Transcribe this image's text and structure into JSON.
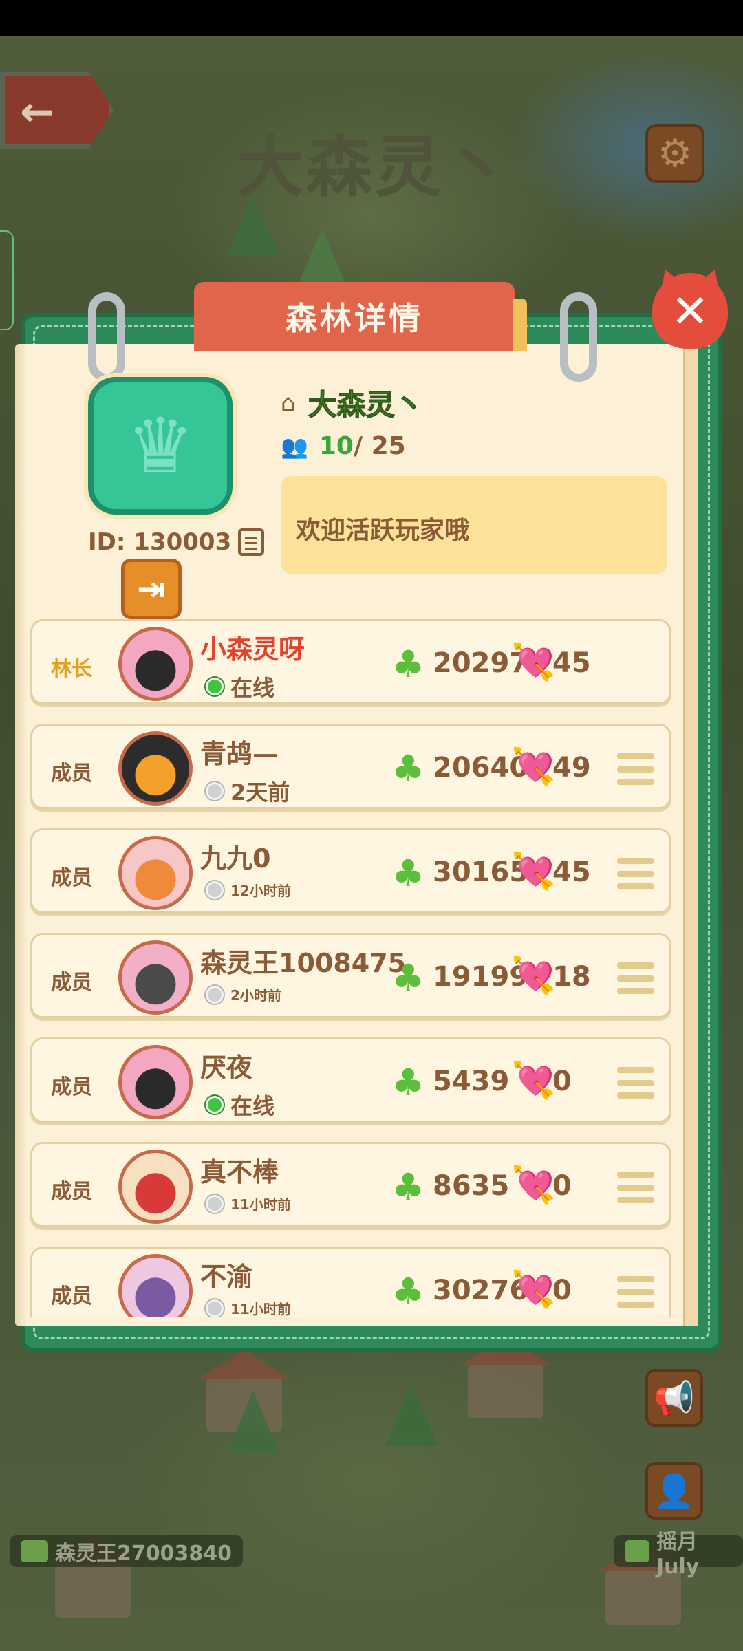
{
  "background": {
    "title": "大森灵丶",
    "bottom_names": [
      "森灵王27003840",
      "摇月July"
    ]
  },
  "panel": {
    "title": "森林详情",
    "forest": {
      "name": "大森灵丶",
      "member_count": "10",
      "member_max": "/ 25",
      "id_label": "ID: 130003",
      "notice": "欢迎活跃玩家哦"
    }
  },
  "members": [
    {
      "role": "林长",
      "name": "小森灵呀",
      "status": "在线",
      "online": true,
      "score": "20297",
      "likes": "45"
    },
    {
      "role": "成员",
      "name": "青鸪—",
      "status": "2天前",
      "online": false,
      "score": "20640",
      "likes": "49"
    },
    {
      "role": "成员",
      "name": "九九0",
      "status": "12小时前",
      "online": false,
      "score": "30165",
      "likes": "45"
    },
    {
      "role": "成员",
      "name": "森灵王1008475",
      "status": "2小时前",
      "online": false,
      "score": "19199",
      "likes": "18"
    },
    {
      "role": "成员",
      "name": "厌夜",
      "status": "在线",
      "online": true,
      "score": "5439",
      "likes": "0"
    },
    {
      "role": "成员",
      "name": "真不棒",
      "status": "11小时前",
      "online": false,
      "score": "8635",
      "likes": "0"
    },
    {
      "role": "成员",
      "name": "不渝",
      "status": "11小时前",
      "online": false,
      "score": "30276",
      "likes": "0"
    }
  ],
  "icons": {
    "back": "back-arrow-icon",
    "settings": "gear-icon",
    "close": "close-icon",
    "home": "home-icon",
    "members": "members-icon",
    "copy": "copy-icon",
    "exit": "exit-icon",
    "clover": "clover-icon",
    "like": "heart-icon",
    "menu": "menu-icon",
    "announce": "megaphone-icon",
    "profile": "profile-icon"
  },
  "colors": {
    "panel_green": "#2c8a5b",
    "page_cream": "#fcf1d6",
    "tab_orange": "#e1654a",
    "leader_name": "#e3432d",
    "online": "#3fc43f",
    "text_brown": "#8b5a36"
  }
}
